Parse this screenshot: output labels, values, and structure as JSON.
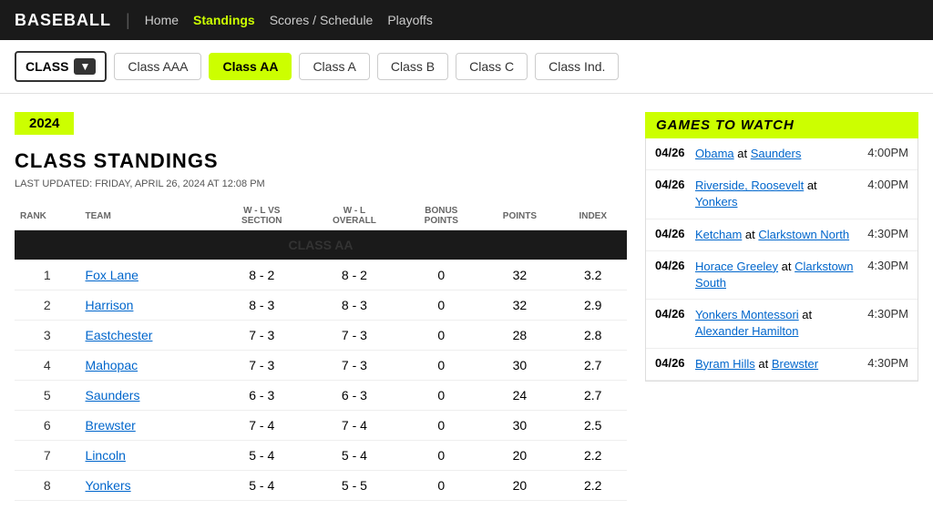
{
  "header": {
    "logo": "BASEBALL",
    "divider": "|",
    "nav": [
      {
        "label": "Home",
        "active": false
      },
      {
        "label": "Standings",
        "active": true
      },
      {
        "label": "Scores / Schedule",
        "active": false
      },
      {
        "label": "Playoffs",
        "active": false
      }
    ]
  },
  "filter": {
    "dropdown_label": "CLASS",
    "buttons": [
      {
        "label": "Class AAA",
        "selected": false
      },
      {
        "label": "Class AA",
        "selected": true
      },
      {
        "label": "Class A",
        "selected": false
      },
      {
        "label": "Class B",
        "selected": false
      },
      {
        "label": "Class C",
        "selected": false
      },
      {
        "label": "Class Ind.",
        "selected": false
      }
    ]
  },
  "standings": {
    "year": "2024",
    "title": "CLASS STANDINGS",
    "last_updated": "LAST UPDATED: FRIDAY, APRIL 26, 2024 AT 12:08 PM",
    "columns": [
      "RANK",
      "TEAM",
      "W - L VS SECTION",
      "W - L OVERALL",
      "BONUS POINTS",
      "POINTS",
      "INDEX"
    ],
    "class_header": "CLASS AA",
    "rows": [
      {
        "rank": "1",
        "team": "Fox Lane",
        "wl_section": "8 - 2",
        "wl_overall": "8 - 2",
        "bonus": "0",
        "points": "32",
        "index": "3.2"
      },
      {
        "rank": "2",
        "team": "Harrison",
        "wl_section": "8 - 3",
        "wl_overall": "8 - 3",
        "bonus": "0",
        "points": "32",
        "index": "2.9"
      },
      {
        "rank": "3",
        "team": "Eastchester",
        "wl_section": "7 - 3",
        "wl_overall": "7 - 3",
        "bonus": "0",
        "points": "28",
        "index": "2.8"
      },
      {
        "rank": "4",
        "team": "Mahopac",
        "wl_section": "7 - 3",
        "wl_overall": "7 - 3",
        "bonus": "0",
        "points": "30",
        "index": "2.7"
      },
      {
        "rank": "5",
        "team": "Saunders",
        "wl_section": "6 - 3",
        "wl_overall": "6 - 3",
        "bonus": "0",
        "points": "24",
        "index": "2.7"
      },
      {
        "rank": "6",
        "team": "Brewster",
        "wl_section": "7 - 4",
        "wl_overall": "7 - 4",
        "bonus": "0",
        "points": "30",
        "index": "2.5"
      },
      {
        "rank": "7",
        "team": "Lincoln",
        "wl_section": "5 - 4",
        "wl_overall": "5 - 4",
        "bonus": "0",
        "points": "20",
        "index": "2.2"
      },
      {
        "rank": "8",
        "team": "Yonkers",
        "wl_section": "5 - 4",
        "wl_overall": "5 - 5",
        "bonus": "0",
        "points": "20",
        "index": "2.2"
      }
    ]
  },
  "games": {
    "title": "GAMES TO WATCH",
    "items": [
      {
        "date": "04/26",
        "home_team": "Obama",
        "at": "at",
        "away_team": "Saunders",
        "time": "4:00PM"
      },
      {
        "date": "04/26",
        "home_team": "Riverside, Roosevelt",
        "at": "at",
        "away_team": "Yonkers",
        "time": "4:00PM"
      },
      {
        "date": "04/26",
        "home_team": "Ketcham",
        "at": "at",
        "away_team": "Clarkstown North",
        "time": "4:30PM"
      },
      {
        "date": "04/26",
        "home_team": "Horace Greeley",
        "at": "at",
        "away_team": "Clarkstown South",
        "time": "4:30PM"
      },
      {
        "date": "04/26",
        "home_team": "Yonkers Montessori",
        "at": "at",
        "away_team": "Alexander Hamilton",
        "time": "4:30PM"
      },
      {
        "date": "04/26",
        "home_team": "Byram Hills",
        "at": "at",
        "away_team": "Brewster",
        "time": "4:30PM"
      }
    ]
  }
}
